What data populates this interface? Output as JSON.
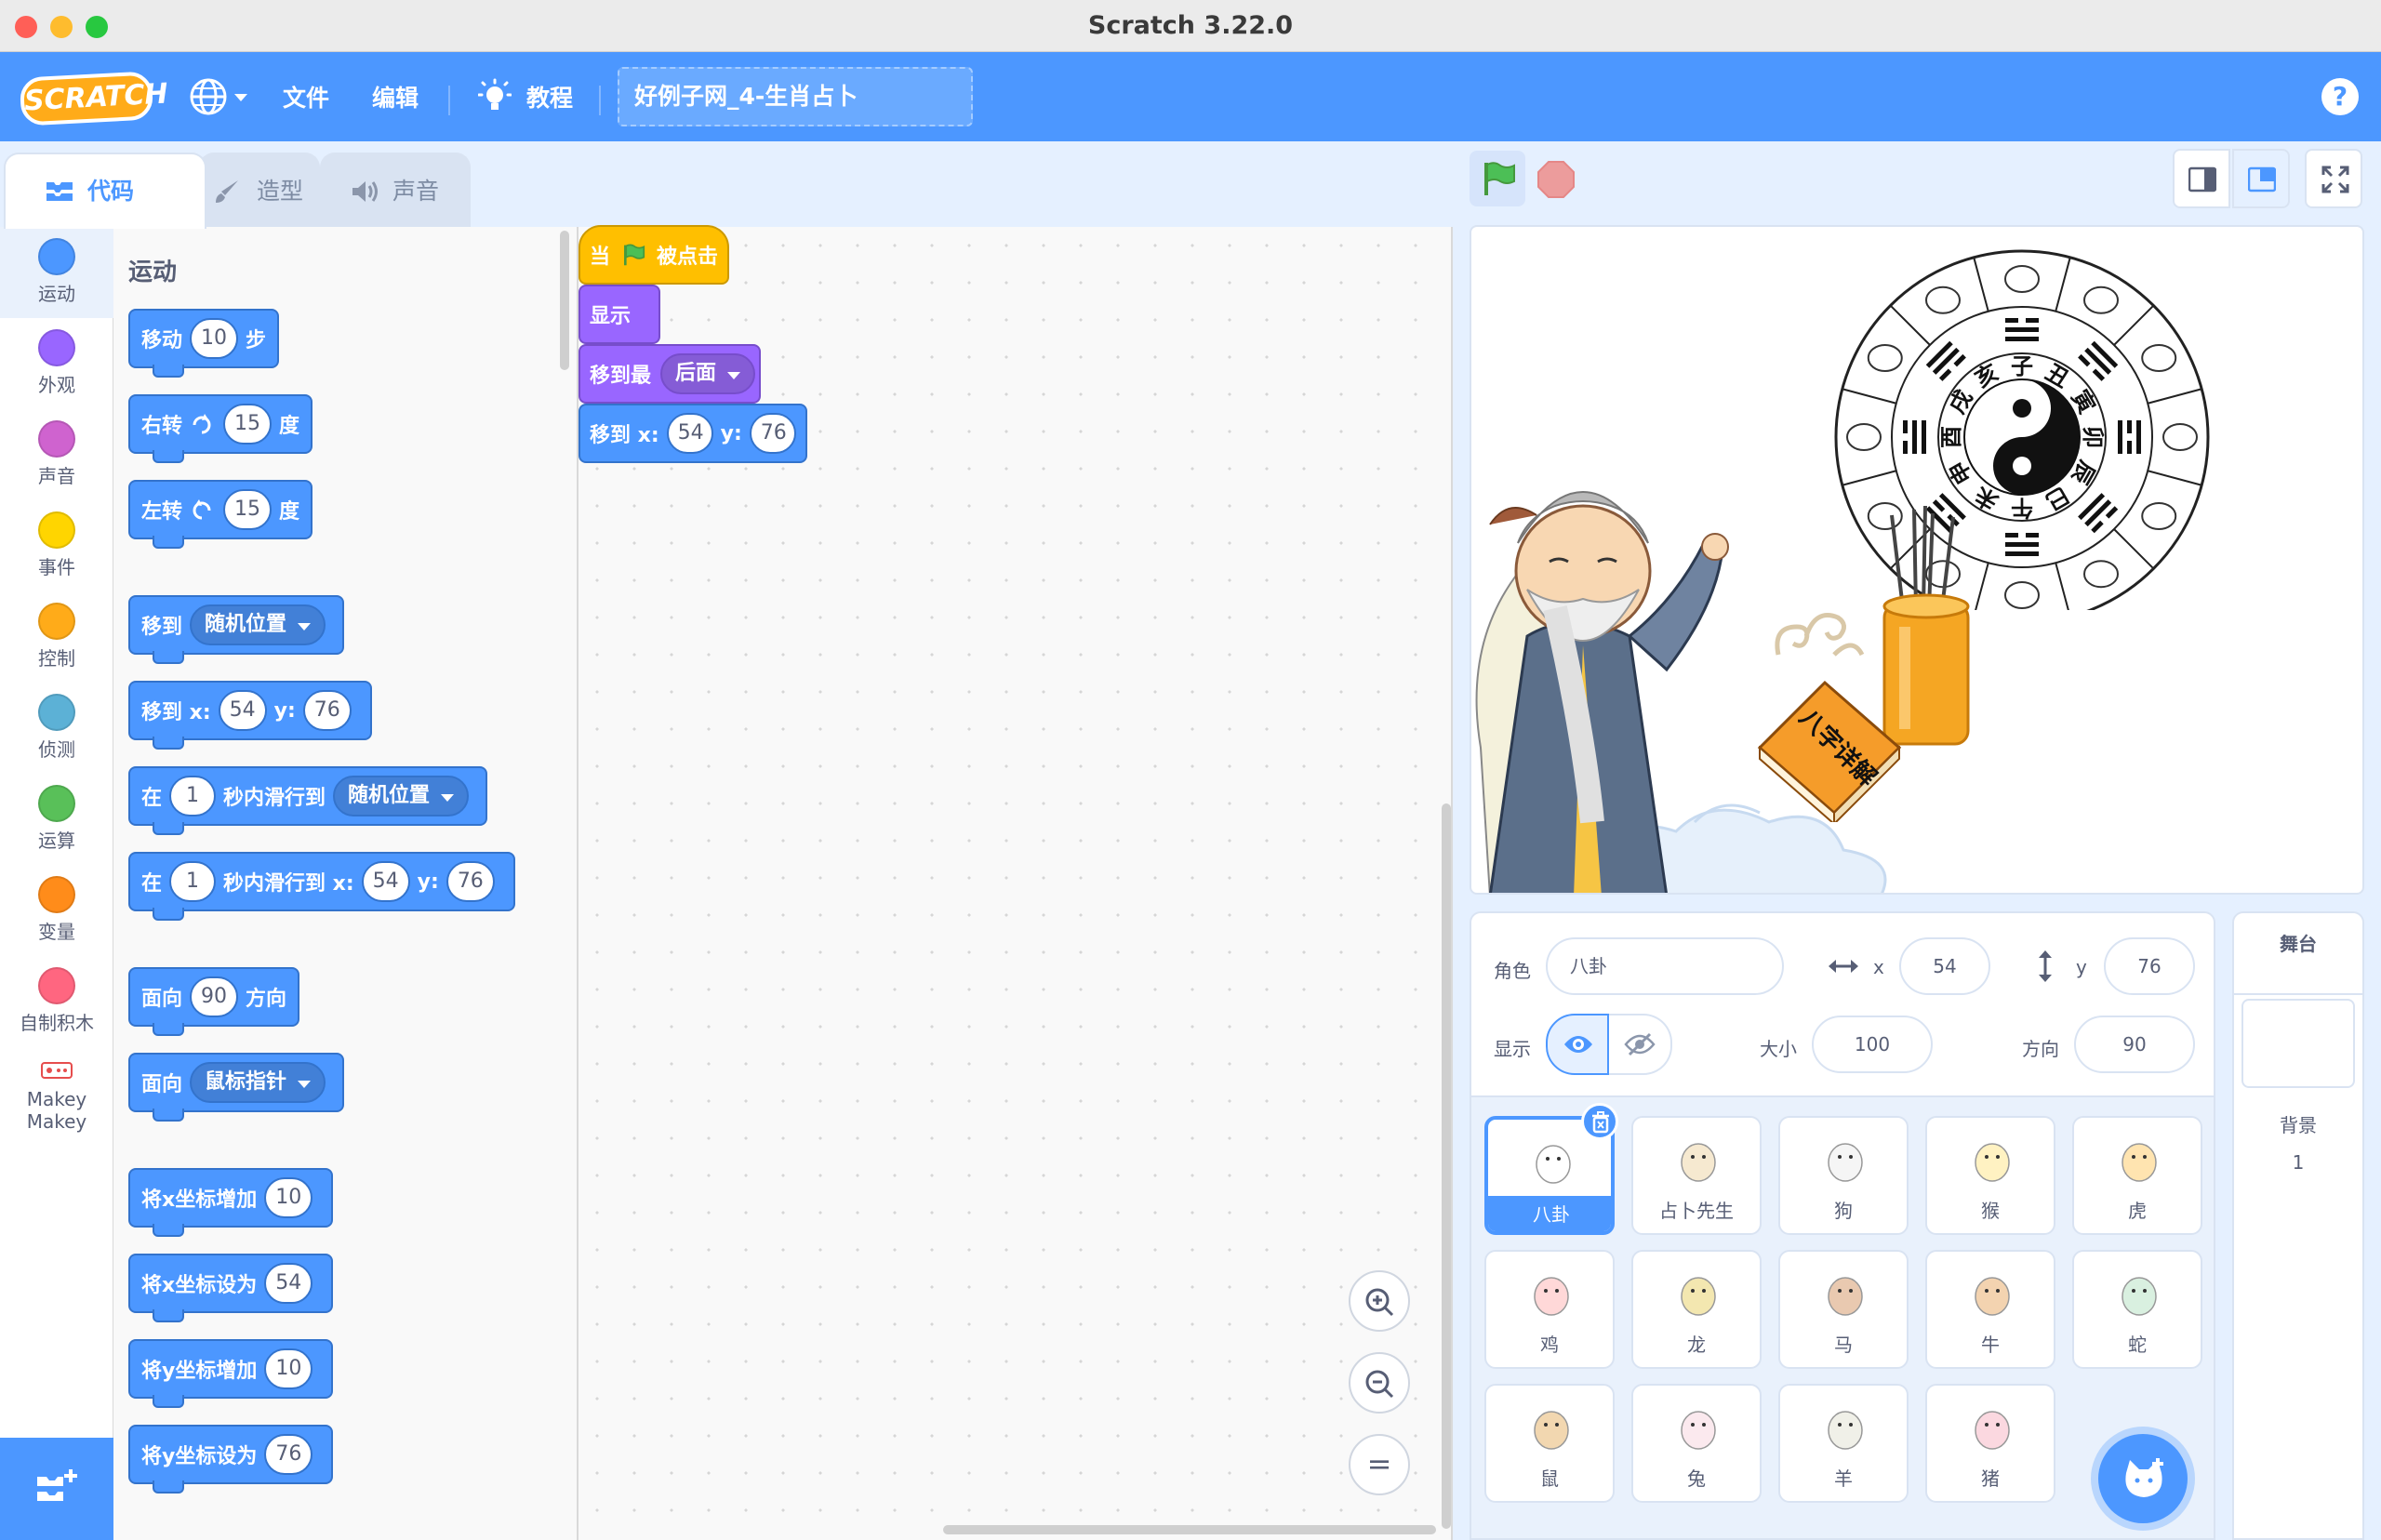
{
  "window": {
    "title": "Scratch 3.22.0"
  },
  "menu": {
    "file": "文件",
    "edit": "编辑",
    "tutorials": "教程",
    "project_title": "好例子网_4-生肖占卜",
    "help": "?",
    "logo": "SCRATCH"
  },
  "tabs": {
    "code": "代码",
    "costumes": "造型",
    "sounds": "声音"
  },
  "categories": [
    {
      "label": "运动",
      "color": "#4c97ff"
    },
    {
      "label": "外观",
      "color": "#9966ff"
    },
    {
      "label": "声音",
      "color": "#cf63cf"
    },
    {
      "label": "事件",
      "color": "#ffd500"
    },
    {
      "label": "控制",
      "color": "#ffab19"
    },
    {
      "label": "侦测",
      "color": "#5cb1d6"
    },
    {
      "label": "运算",
      "color": "#59c059"
    },
    {
      "label": "变量",
      "color": "#ff8c1a"
    },
    {
      "label": "自制积木",
      "color": "#ff6680"
    },
    {
      "label": "Makey\nMakey",
      "color": "#e64d4d"
    }
  ],
  "palette": {
    "title": "运动",
    "b1": {
      "a": "移动",
      "v": "10",
      "b": "步"
    },
    "b2": {
      "a": "右转",
      "v": "15",
      "b": "度"
    },
    "b3": {
      "a": "左转",
      "v": "15",
      "b": "度"
    },
    "b4": {
      "a": "移到",
      "dd": "随机位置"
    },
    "b5": {
      "a": "移到 x:",
      "x": "54",
      "yl": "y:",
      "y": "76"
    },
    "b6": {
      "a": "在",
      "v": "1",
      "b": "秒内滑行到",
      "dd": "随机位置"
    },
    "b7": {
      "a": "在",
      "v": "1",
      "b": "秒内滑行到 x:",
      "x": "54",
      "yl": "y:",
      "y": "76"
    },
    "b8": {
      "a": "面向",
      "v": "90",
      "b": "方向"
    },
    "b9": {
      "a": "面向",
      "dd": "鼠标指针"
    },
    "b10": {
      "a": "将x坐标增加",
      "v": "10"
    },
    "b11": {
      "a": "将x坐标设为",
      "v": "54"
    },
    "b12": {
      "a": "将y坐标增加",
      "v": "10"
    },
    "b13": {
      "a": "将y坐标设为",
      "v": "76"
    }
  },
  "script": {
    "hat": {
      "a": "当",
      "b": "被点击"
    },
    "show": "显示",
    "goto_layer": {
      "a": "移到最",
      "dd": "后面"
    },
    "goto_xy": {
      "a": "移到 x:",
      "x": "54",
      "yl": "y:",
      "y": "76"
    }
  },
  "zoom": {
    "in": "+",
    "out": "−",
    "reset": "="
  },
  "sprite_info": {
    "sprite_label": "角色",
    "name": "八卦",
    "x_label": "x",
    "x": "54",
    "y_label": "y",
    "y": "76",
    "show_label": "显示",
    "size_label": "大小",
    "size": "100",
    "direction_label": "方向",
    "direction": "90"
  },
  "sprites": [
    "八卦",
    "占卜先生",
    "狗",
    "猴",
    "虎",
    "鸡",
    "龙",
    "马",
    "牛",
    "蛇",
    "鼠",
    "兔",
    "羊",
    "猪"
  ],
  "stage_panel": {
    "title": "舞台",
    "backdrop_label": "背景",
    "backdrop_count": "1"
  },
  "stage_art": {
    "wheel_chars": [
      "亥",
      "子",
      "丑",
      "寅",
      "卯",
      "辰",
      "巳",
      "午",
      "未",
      "申",
      "酉",
      "戌"
    ],
    "book_text": "八字详解"
  }
}
